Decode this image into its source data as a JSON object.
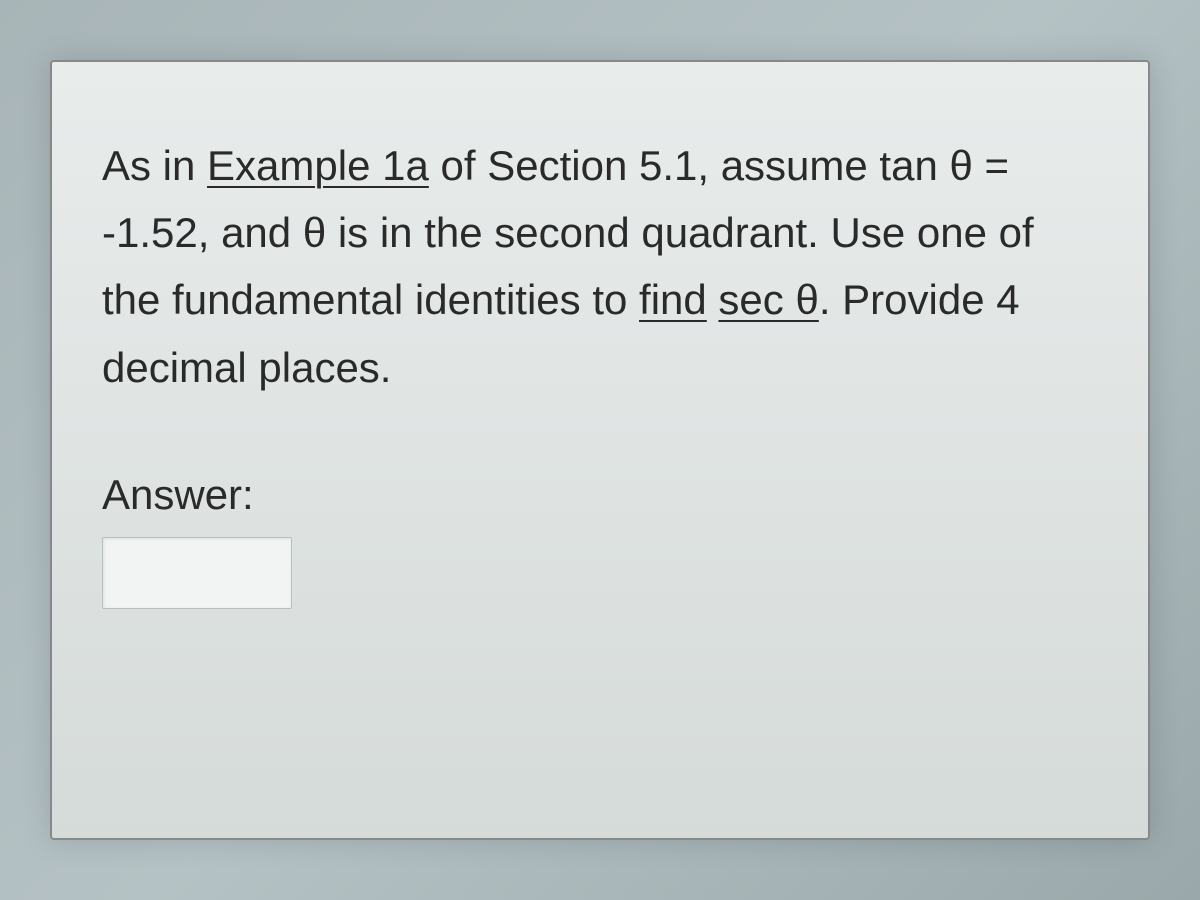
{
  "question": {
    "part1_prefix": "As in ",
    "example_link": "Example 1a",
    "part1_suffix": " of Section 5.1, assume tan ",
    "part2": "θ = -1.52, and θ is in the second quadrant. ",
    "part3_prefix": "Use one of the fundamental identities to ",
    "find_link": "find",
    "sec_link": "sec θ",
    "part4_suffix": ".  Provide 4 decimal places."
  },
  "answer": {
    "label": "Answer:",
    "value": ""
  }
}
